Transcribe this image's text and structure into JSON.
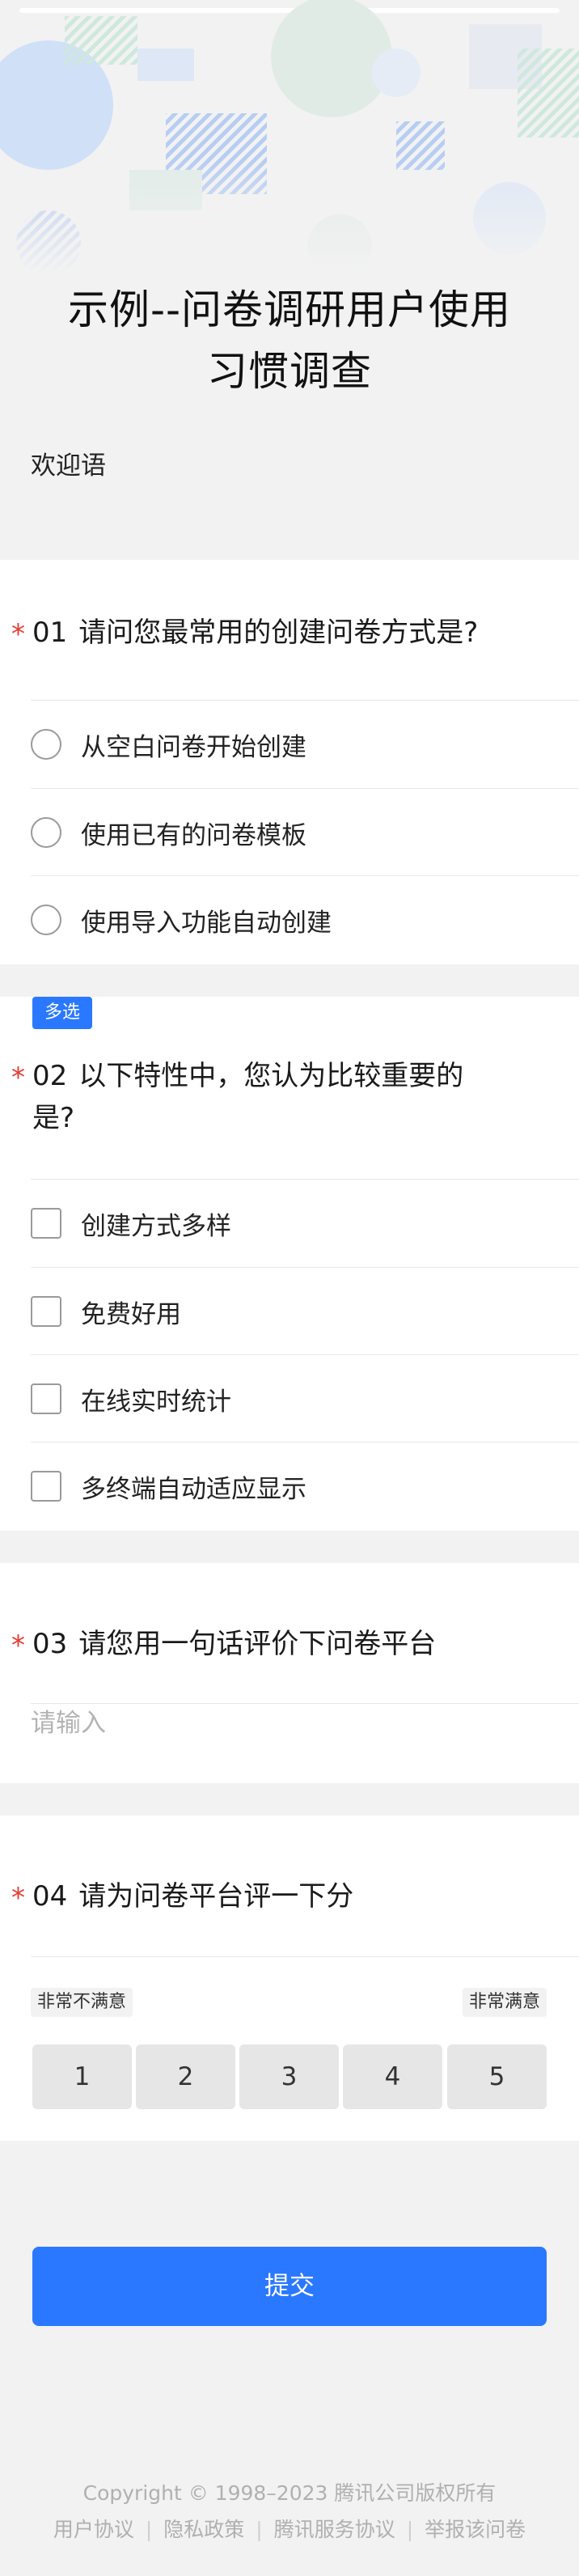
{
  "header": {
    "title_line1": "示例--问卷调研用户使用",
    "title_line2": "习惯调查",
    "welcome": "欢迎语"
  },
  "questions": [
    {
      "number": "01",
      "required_mark": "*",
      "text": "请问您最常用的创建问卷方式是?",
      "options": [
        "从空白问卷开始创建",
        "使用已有的问卷模板",
        "使用导入功能自动创建"
      ]
    },
    {
      "number": "02",
      "required_mark": "*",
      "tag": "多选",
      "text_line1": "以下特性中，您认为比较重要的",
      "text_line2": "是?",
      "options": [
        "创建方式多样",
        "免费好用",
        "在线实时统计",
        "多终端自动适应显示"
      ]
    },
    {
      "number": "03",
      "required_mark": "*",
      "text": "请您用一句话评价下问卷平台",
      "placeholder": "请输入"
    },
    {
      "number": "04",
      "required_mark": "*",
      "text": "请为问卷平台评一下分",
      "low_label": "非常不满意",
      "high_label": "非常满意",
      "scale": [
        "1",
        "2",
        "3",
        "4",
        "5"
      ]
    }
  ],
  "submit_label": "提交",
  "footer": {
    "copyright": "Copyright © 1998–2023 腾讯公司版权所有",
    "links": [
      "用户协议",
      "隐私政策",
      "腾讯服务协议",
      "举报该问卷"
    ],
    "separator": "|"
  },
  "colors": {
    "accent": "#2a78ff",
    "required": "#e43d33",
    "background": "#f2f2f2"
  }
}
